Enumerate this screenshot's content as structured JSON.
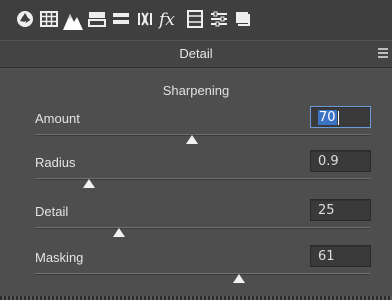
{
  "toolbar": {
    "icons": [
      "aperture-icon",
      "grid-icon",
      "mountains-icon",
      "split-toning-icon",
      "lens-icon",
      "vignette-icon",
      "fx-icon",
      "film-strip-icon",
      "sliders-icon",
      "presets-icon"
    ],
    "active_icon": "mountains-icon"
  },
  "panel": {
    "title": "Detail"
  },
  "sharpening": {
    "title": "Sharpening",
    "rows": [
      {
        "label": "Amount",
        "value": "70",
        "slider_fraction": 0.47
      },
      {
        "label": "Radius",
        "value": "0.9",
        "slider_fraction": 0.16
      },
      {
        "label": "Detail",
        "value": "25",
        "slider_fraction": 0.25
      },
      {
        "label": "Masking",
        "value": "61",
        "slider_fraction": 0.61
      }
    ]
  },
  "colors": {
    "panel_bg": "#4e4e4e",
    "toolbar_bg": "#3f3f3f",
    "selection": "#3b73c6",
    "thumb": "#f2f2f2"
  }
}
